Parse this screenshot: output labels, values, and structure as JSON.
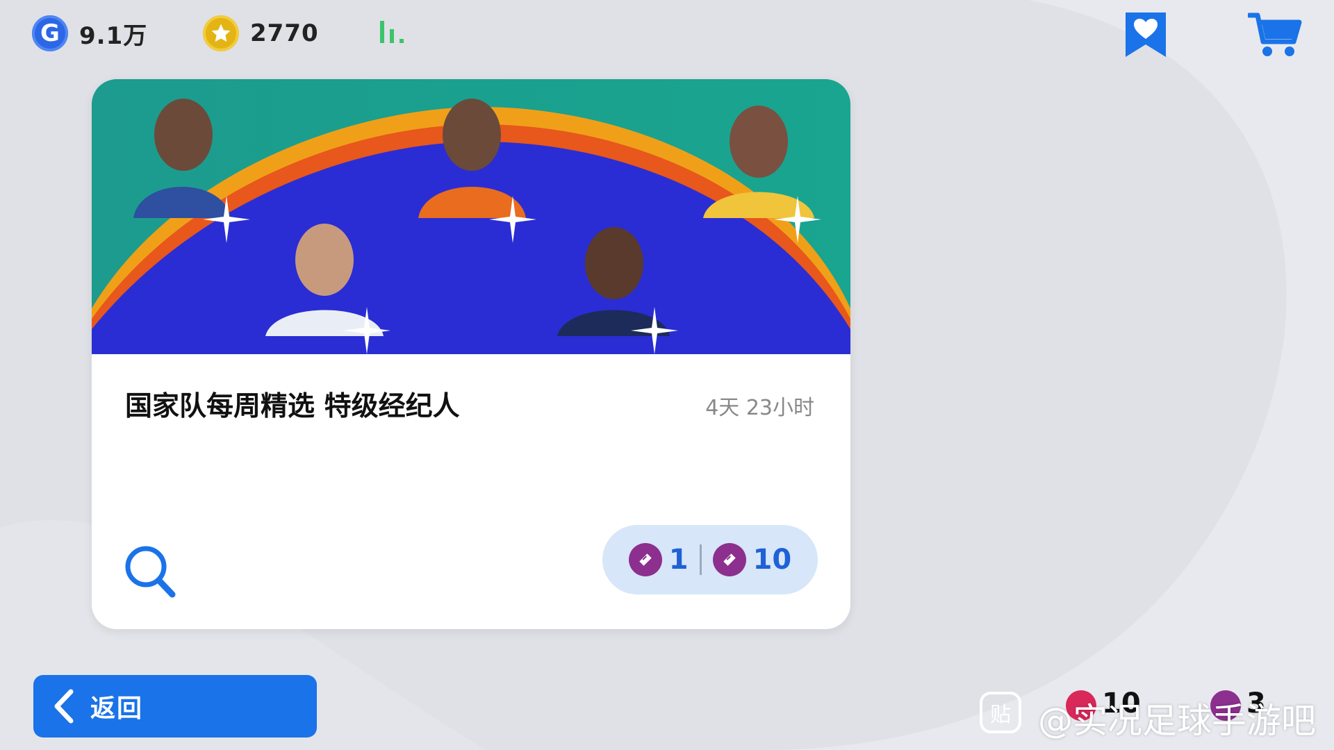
{
  "top_bar": {
    "gp_label": "9.1万",
    "coin_label": "2770",
    "gp_icon_letter": "G"
  },
  "card": {
    "title": "国家队每周精选 特级经纪人",
    "timer": "4天 23小时",
    "price_single": "1",
    "price_multi": "10"
  },
  "back_button": {
    "label": "返回"
  },
  "bottom_right": {
    "ticket_red_count": "10",
    "ticket_purple_count": "3"
  },
  "watermark": {
    "logo_char": "贴",
    "text": "@实况足球手游吧"
  },
  "colors": {
    "accent_blue": "#1a73e8",
    "banner_blue": "#2a2dd4",
    "ticket_purple": "#8c2f8e",
    "ticket_red": "#d9285a"
  }
}
